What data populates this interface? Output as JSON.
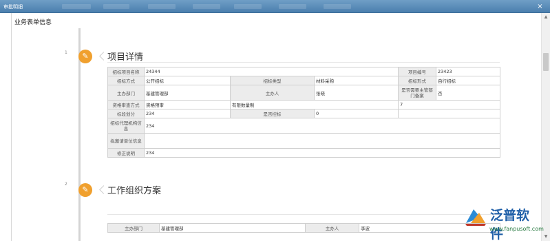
{
  "window": {
    "title": "审批明细",
    "close_glyph": "×"
  },
  "page": {
    "section_header": "业务表单信息"
  },
  "timeline": [
    {
      "number": "1",
      "icon": "pencil-icon",
      "title": "项目详情"
    },
    {
      "number": "2",
      "icon": "pencil-icon",
      "title": "工作组织方案"
    }
  ],
  "project_details": {
    "row1": {
      "label_a": "招标项目名称",
      "value_a": "24344",
      "label_b": "项目编号",
      "value_b": "23423"
    },
    "row2": {
      "label_a": "招标方式",
      "value_a": "公开招标",
      "label_b": "招标类型",
      "value_b": "材料采购",
      "label_c": "招标形式",
      "value_c": "自行招标"
    },
    "row3": {
      "label_a": "主办部门",
      "value_a": "基建管理部",
      "label_b": "主办人",
      "value_b": "张晓",
      "label_c": "是否需要主管部门备案",
      "value_c": "否"
    },
    "row4": {
      "label_a": "资格审查方式",
      "value_a": "资格预审",
      "value_b": "有限数量制",
      "value_c": "7"
    },
    "row5": {
      "label_a": "标段划分",
      "value_a": "234",
      "label_b": "是否控标",
      "value_b": "0"
    },
    "row6": {
      "label_a": "招标代理机构信息",
      "value_a": "234"
    },
    "row7": {
      "label_a": "拟邀请单位信息",
      "value_a": ""
    },
    "row8": {
      "label_a": "修正说明",
      "value_a": "234"
    }
  },
  "work_plan": {
    "row1": {
      "label_a": "主办部门",
      "value_a": "基建管理部",
      "label_b": "主办人",
      "value_b": "李波"
    }
  },
  "watermark": {
    "brand": "泛普软件",
    "url": "www.fanpusoft.com",
    "brand_color": "#1f5fa8",
    "url_color": "#2b7c44"
  },
  "colors": {
    "titlebar": "#5a8dbb",
    "badge": "#f0a02e",
    "label_bg": "#ececec"
  }
}
